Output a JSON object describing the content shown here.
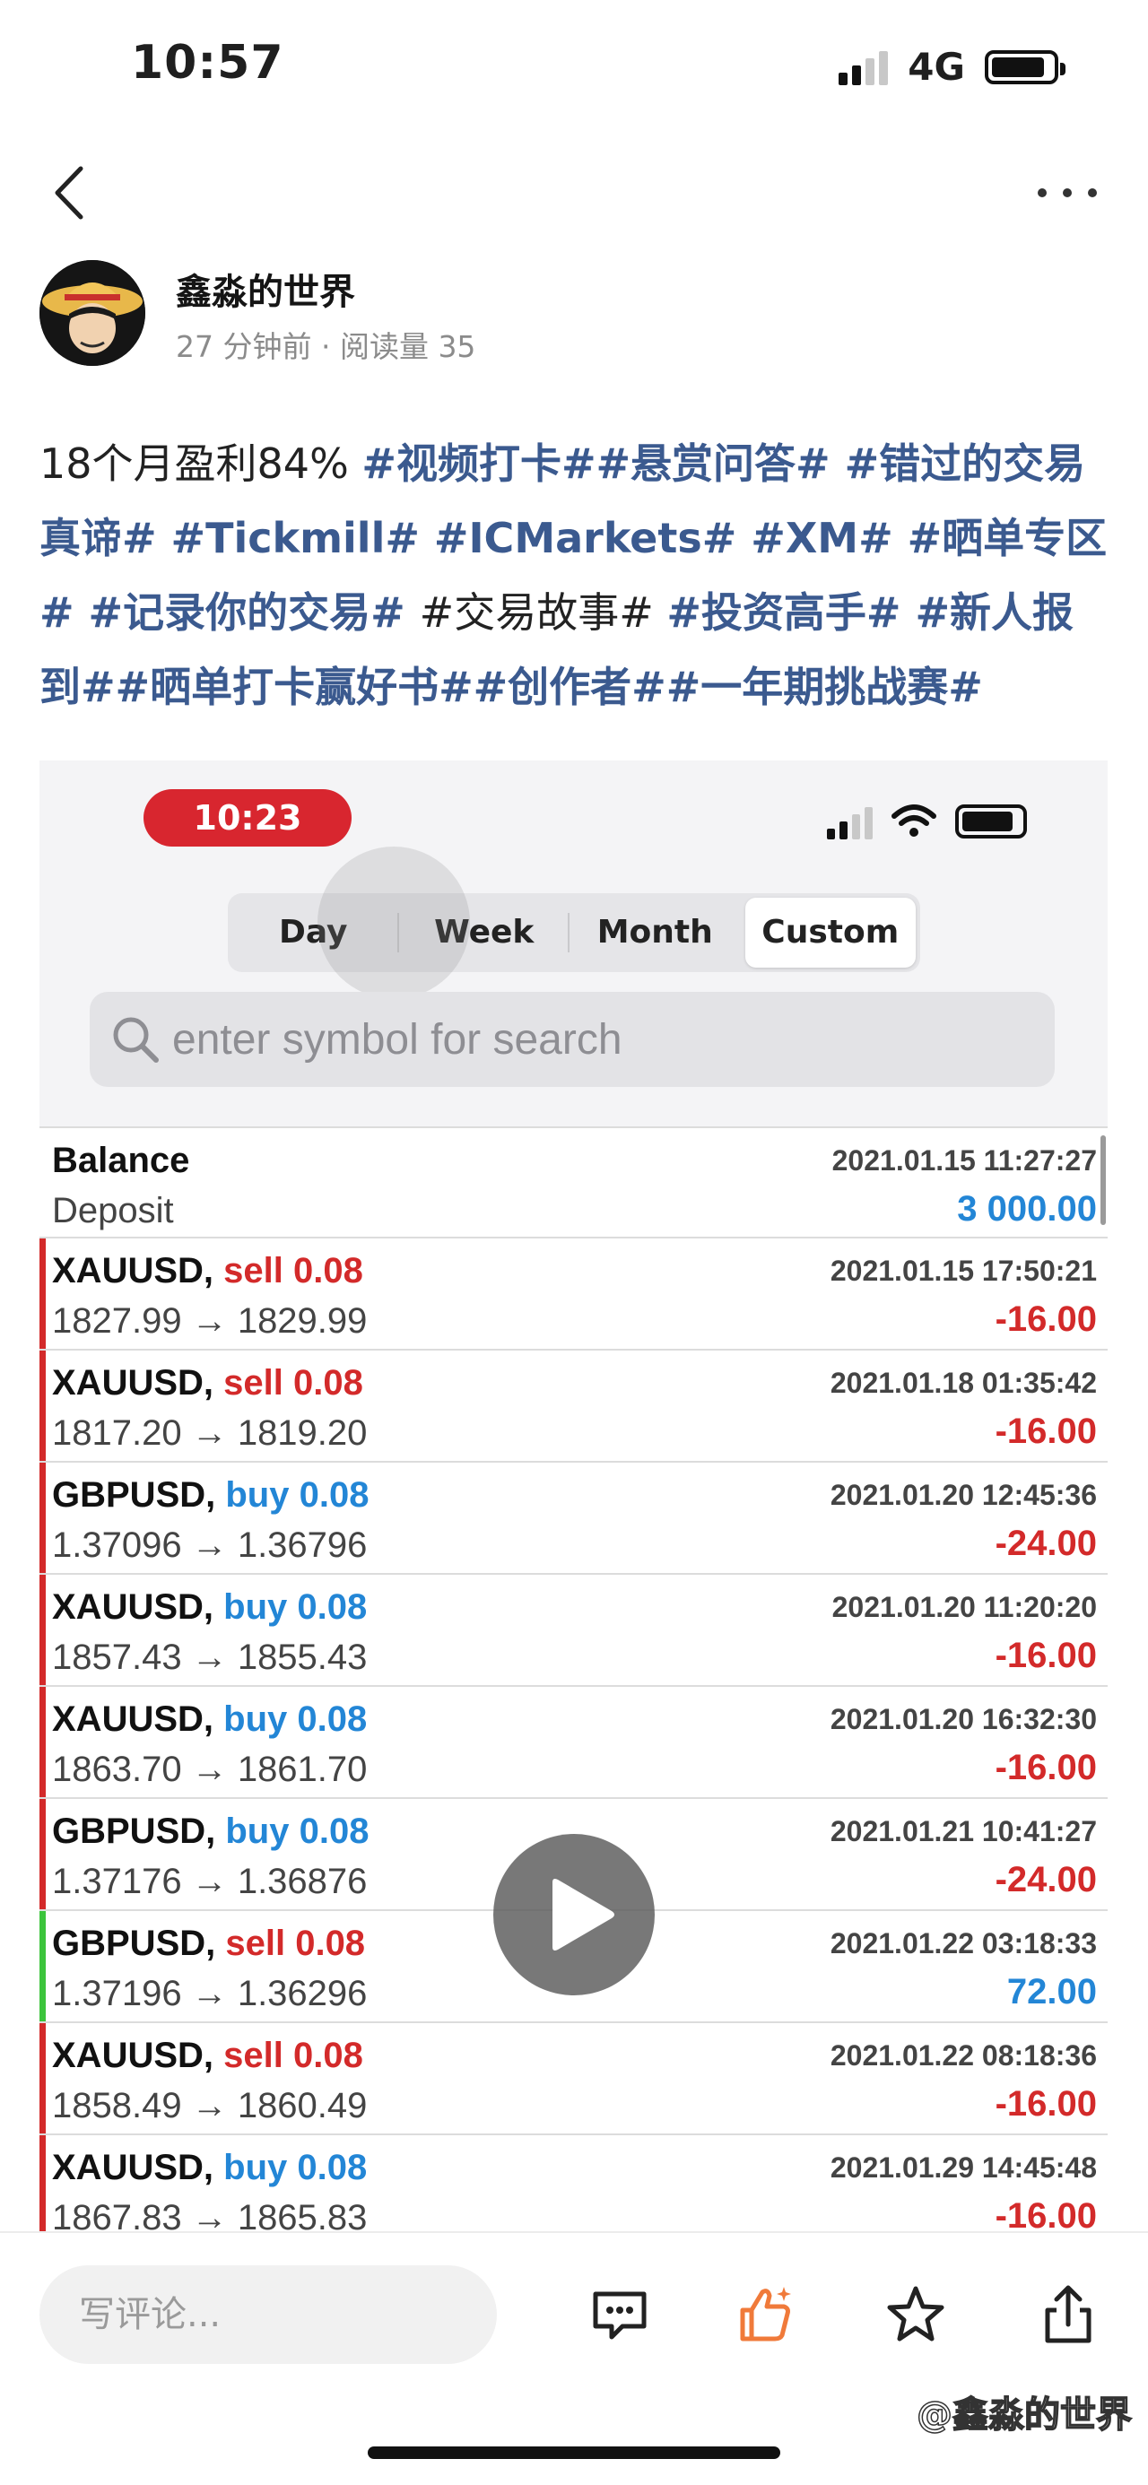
{
  "status_bar": {
    "time": "10:57",
    "network": "4G"
  },
  "author": {
    "name": "鑫淼的世界",
    "meta": "27 分钟前 · 阅读量 35"
  },
  "post": {
    "segments": [
      {
        "text": "18个月盈利84% ",
        "style": "plain"
      },
      {
        "text": "#视频打卡##悬赏问答# #错过的交易真谛# #Tickmill# #ICMarkets# #XM# #晒单专区# #记录你的交易# ",
        "style": "tag"
      },
      {
        "text": "#交易故事# ",
        "style": "plain"
      },
      {
        "text": "#投资高手# #新人报到##晒单打卡赢好书##创作者##一年期挑战赛#",
        "style": "tag"
      }
    ]
  },
  "embed": {
    "time": "10:23",
    "periods": [
      "Day",
      "Week",
      "Month",
      "Custom"
    ],
    "active_period": "Custom",
    "search_placeholder": "enter symbol for search",
    "colors": {
      "loss": "#d32a2a",
      "profit": "#2386d6",
      "sell": "#d32a2a",
      "buy": "#2386d6",
      "gain_bar": "#3cc43c"
    },
    "rows": [
      {
        "symbol": "Balance",
        "side": "",
        "lots": "",
        "sub": "Deposit",
        "date": "2021.01.15 11:27:27",
        "amount": "3 000.00",
        "kind": "deposit"
      },
      {
        "symbol": "XAUUSD, ",
        "side": "sell",
        "lots": "0.08",
        "sub": "1827.99 → 1829.99",
        "date": "2021.01.15 17:50:21",
        "amount": "-16.00",
        "kind": "loss"
      },
      {
        "symbol": "XAUUSD, ",
        "side": "sell",
        "lots": "0.08",
        "sub": "1817.20 → 1819.20",
        "date": "2021.01.18 01:35:42",
        "amount": "-16.00",
        "kind": "loss"
      },
      {
        "symbol": "GBPUSD, ",
        "side": "buy",
        "lots": "0.08",
        "sub": "1.37096 → 1.36796",
        "date": "2021.01.20 12:45:36",
        "amount": "-24.00",
        "kind": "loss"
      },
      {
        "symbol": "XAUUSD, ",
        "side": "buy",
        "lots": "0.08",
        "sub": "1857.43 → 1855.43",
        "date": "2021.01.20 11:20:20",
        "amount": "-16.00",
        "kind": "loss"
      },
      {
        "symbol": "XAUUSD, ",
        "side": "buy",
        "lots": "0.08",
        "sub": "1863.70 → 1861.70",
        "date": "2021.01.20 16:32:30",
        "amount": "-16.00",
        "kind": "loss"
      },
      {
        "symbol": "GBPUSD, ",
        "side": "buy",
        "lots": "0.08",
        "sub": "1.37176 → 1.36876",
        "date": "2021.01.21 10:41:27",
        "amount": "-24.00",
        "kind": "loss"
      },
      {
        "symbol": "GBPUSD, ",
        "side": "sell",
        "lots": "0.08",
        "sub": "1.37196 → 1.36296",
        "date": "2021.01.22 03:18:33",
        "amount": "72.00",
        "kind": "profit"
      },
      {
        "symbol": "XAUUSD, ",
        "side": "sell",
        "lots": "0.08",
        "sub": "1858.49 → 1860.49",
        "date": "2021.01.22 08:18:36",
        "amount": "-16.00",
        "kind": "loss"
      },
      {
        "symbol": "XAUUSD, ",
        "side": "buy",
        "lots": "0.08",
        "sub": "1867.83 → 1865.83",
        "date": "2021.01.29 14:45:48",
        "amount": "-16.00",
        "kind": "loss"
      }
    ]
  },
  "bottom": {
    "comment_placeholder": "写评论...",
    "like_color": "#f07a3a"
  },
  "watermark": "@鑫淼的世界"
}
